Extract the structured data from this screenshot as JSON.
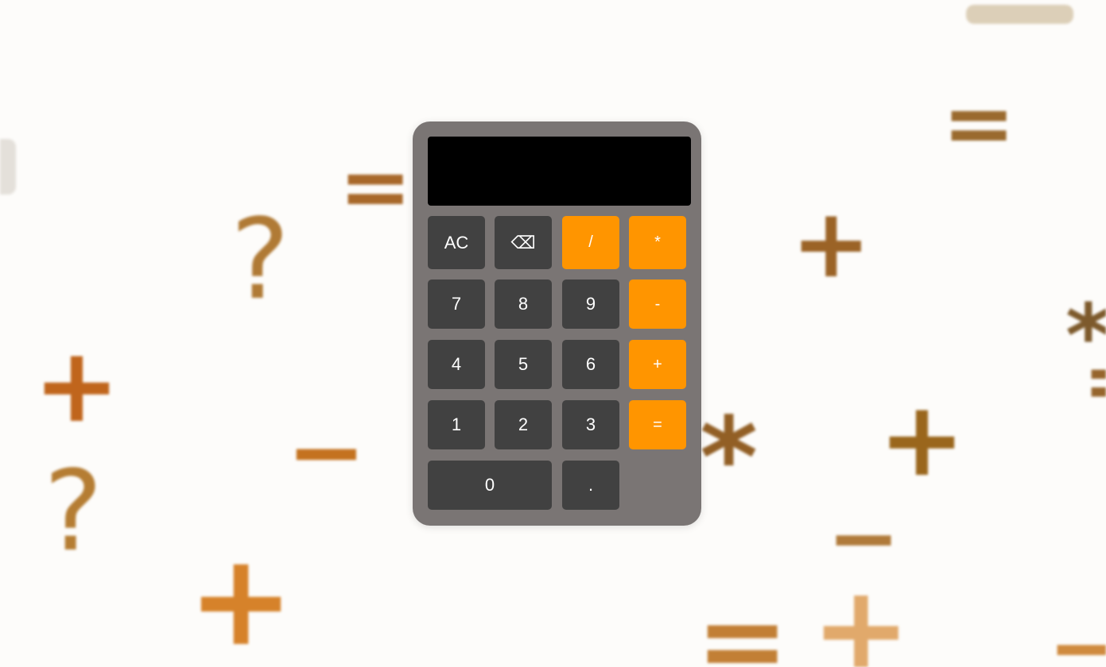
{
  "calculator": {
    "display_value": "",
    "keys": {
      "clear": "AC",
      "backspace": "⌫",
      "divide": "/",
      "multiply": "*",
      "seven": "7",
      "eight": "8",
      "nine": "9",
      "subtract": "-",
      "four": "4",
      "five": "5",
      "six": "6",
      "add": "+",
      "one": "1",
      "two": "2",
      "three": "3",
      "equals": "=",
      "zero": "0",
      "decimal": "."
    }
  },
  "colors": {
    "body": "#7a7574",
    "display": "#000000",
    "number_key": "#414141",
    "operator_key": "#ff9500"
  },
  "background": {
    "symbols": [
      "?",
      "=",
      "+",
      "−",
      "*"
    ]
  }
}
